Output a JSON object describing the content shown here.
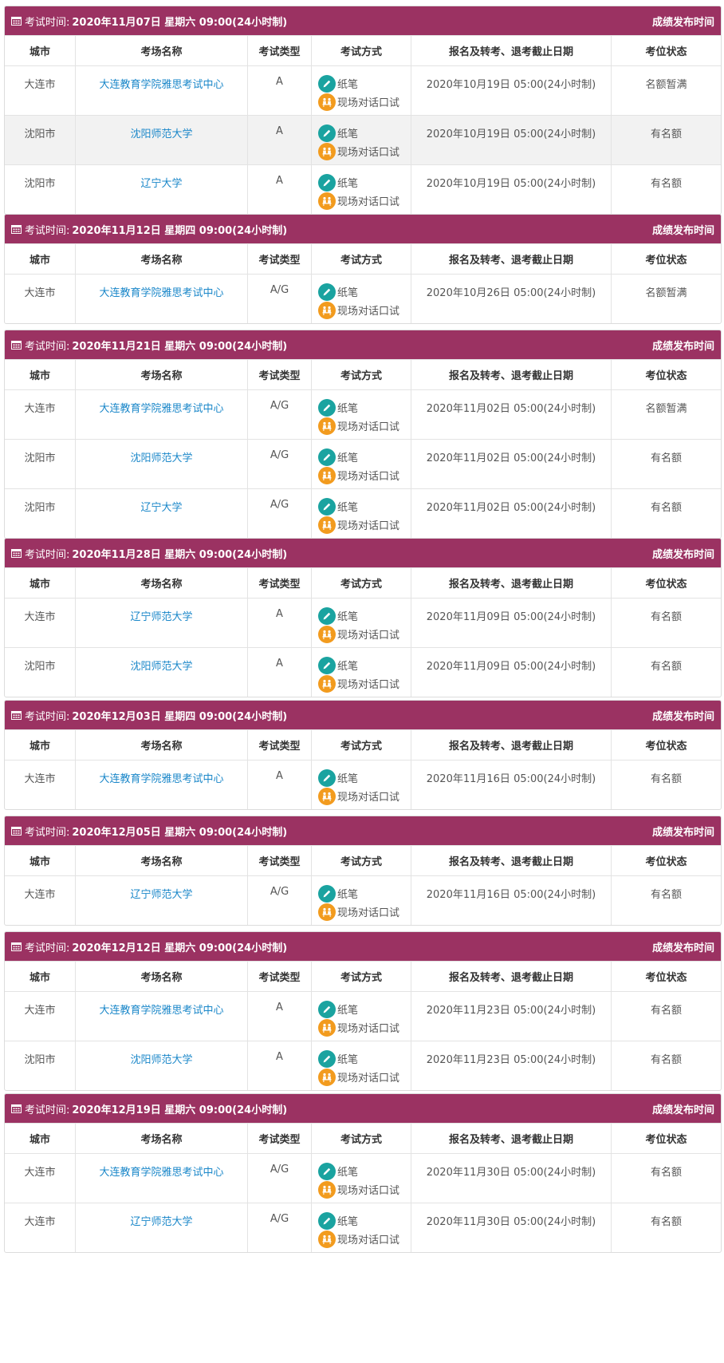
{
  "labels": {
    "exam_time_prefix": "考试时间:",
    "results_link": "成绩发布时间",
    "method_paper": "纸笔",
    "method_speaking": "现场对话口试"
  },
  "columns": [
    "城市",
    "考场名称",
    "考试类型",
    "考试方式",
    "报名及转考、退考截止日期",
    "考位状态"
  ],
  "icons": {
    "header": "calendar-icon",
    "paper": "pencil-icon",
    "speaking": "face-to-face-icon"
  },
  "colors": {
    "header_bg": "#9b3262",
    "link": "#1a87c9",
    "paper_icon": "#1aa3a0",
    "speaking_icon": "#f29b1e"
  },
  "sessions": [
    {
      "time": "2020年11月07日 星期六 09:00(24小时制)",
      "rows": [
        {
          "city": "大连市",
          "venue": "大连教育学院雅思考试中心",
          "type": "A",
          "deadline": "2020年10月19日 05:00(24小时制)",
          "status": "名额暂满"
        },
        {
          "city": "沈阳市",
          "venue": "沈阳师范大学",
          "type": "A",
          "deadline": "2020年10月19日 05:00(24小时制)",
          "status": "有名额",
          "highlight": true
        },
        {
          "city": "沈阳市",
          "venue": "辽宁大学",
          "type": "A",
          "deadline": "2020年10月19日 05:00(24小时制)",
          "status": "有名额"
        }
      ]
    },
    {
      "time": "2020年11月12日 星期四 09:00(24小时制)",
      "rows": [
        {
          "city": "大连市",
          "venue": "大连教育学院雅思考试中心",
          "type": "A/G",
          "deadline": "2020年10月26日 05:00(24小时制)",
          "status": "名额暂满"
        }
      ]
    },
    {
      "time": "2020年11月21日 星期六 09:00(24小时制)",
      "rows": [
        {
          "city": "大连市",
          "venue": "大连教育学院雅思考试中心",
          "type": "A/G",
          "deadline": "2020年11月02日 05:00(24小时制)",
          "status": "名额暂满"
        },
        {
          "city": "沈阳市",
          "venue": "沈阳师范大学",
          "type": "A/G",
          "deadline": "2020年11月02日 05:00(24小时制)",
          "status": "有名额"
        },
        {
          "city": "沈阳市",
          "venue": "辽宁大学",
          "type": "A/G",
          "deadline": "2020年11月02日 05:00(24小时制)",
          "status": "有名额"
        }
      ]
    },
    {
      "time": "2020年11月28日 星期六 09:00(24小时制)",
      "rows": [
        {
          "city": "大连市",
          "venue": "辽宁师范大学",
          "type": "A",
          "deadline": "2020年11月09日 05:00(24小时制)",
          "status": "有名额"
        },
        {
          "city": "沈阳市",
          "venue": "沈阳师范大学",
          "type": "A",
          "deadline": "2020年11月09日 05:00(24小时制)",
          "status": "有名额"
        }
      ]
    },
    {
      "time": "2020年12月03日 星期四 09:00(24小时制)",
      "rows": [
        {
          "city": "大连市",
          "venue": "大连教育学院雅思考试中心",
          "type": "A",
          "deadline": "2020年11月16日 05:00(24小时制)",
          "status": "有名额"
        }
      ]
    },
    {
      "time": "2020年12月05日 星期六 09:00(24小时制)",
      "rows": [
        {
          "city": "大连市",
          "venue": "辽宁师范大学",
          "type": "A/G",
          "deadline": "2020年11月16日 05:00(24小时制)",
          "status": "有名额"
        }
      ]
    },
    {
      "time": "2020年12月12日 星期六 09:00(24小时制)",
      "rows": [
        {
          "city": "大连市",
          "venue": "大连教育学院雅思考试中心",
          "type": "A",
          "deadline": "2020年11月23日 05:00(24小时制)",
          "status": "有名额"
        },
        {
          "city": "沈阳市",
          "venue": "沈阳师范大学",
          "type": "A",
          "deadline": "2020年11月23日 05:00(24小时制)",
          "status": "有名额"
        }
      ]
    },
    {
      "time": "2020年12月19日 星期六 09:00(24小时制)",
      "rows": [
        {
          "city": "大连市",
          "venue": "大连教育学院雅思考试中心",
          "type": "A/G",
          "deadline": "2020年11月30日 05:00(24小时制)",
          "status": "有名额"
        },
        {
          "city": "大连市",
          "venue": "辽宁师范大学",
          "type": "A/G",
          "deadline": "2020年11月30日 05:00(24小时制)",
          "status": "有名额"
        }
      ]
    }
  ]
}
